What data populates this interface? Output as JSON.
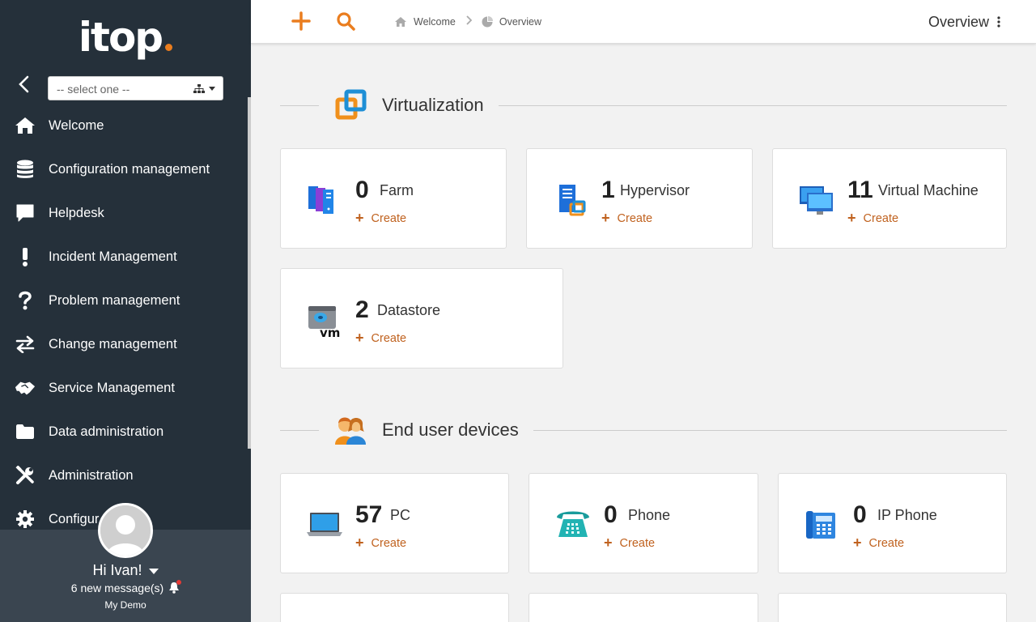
{
  "brand": {
    "name": "itop",
    "accent": "#ea7d1e"
  },
  "org_select": {
    "placeholder": "-- select one --"
  },
  "menu": [
    {
      "label": "Welcome",
      "icon": "home-icon"
    },
    {
      "label": "Configuration management",
      "icon": "database-icon"
    },
    {
      "label": "Helpdesk",
      "icon": "chat-icon"
    },
    {
      "label": "Incident Management",
      "icon": "exclamation-icon"
    },
    {
      "label": "Problem management",
      "icon": "question-icon"
    },
    {
      "label": "Change management",
      "icon": "arrows-exchange-icon"
    },
    {
      "label": "Service Management",
      "icon": "handshake-icon"
    },
    {
      "label": "Data administration",
      "icon": "folder-icon"
    },
    {
      "label": "Administration",
      "icon": "tools-icon"
    },
    {
      "label": "Configur",
      "icon": "gear-icon"
    }
  ],
  "user": {
    "greeting": "Hi Ivan!",
    "messages": "6 new message(s)",
    "org": "My Demo"
  },
  "breadcrumb": [
    {
      "label": "Welcome",
      "icon": "home-icon"
    },
    {
      "label": "Overview",
      "icon": "pie-chart-icon"
    }
  ],
  "page_title": "Overview",
  "sections": [
    {
      "title": "Virtualization",
      "cards": [
        {
          "count": "0",
          "label": "Farm",
          "create": "Create",
          "icon": "farm-icon"
        },
        {
          "count": "1",
          "label": "Hypervisor",
          "create": "Create",
          "icon": "hypervisor-icon"
        },
        {
          "count": "11",
          "label": "Virtual Machine",
          "create": "Create",
          "icon": "virtual-machine-icon"
        },
        {
          "count": "2",
          "label": "Datastore",
          "create": "Create",
          "icon": "datastore-icon"
        }
      ]
    },
    {
      "title": "End user devices",
      "cards": [
        {
          "count": "57",
          "label": "PC",
          "create": "Create",
          "icon": "laptop-icon"
        },
        {
          "count": "0",
          "label": "Phone",
          "create": "Create",
          "icon": "phone-icon"
        },
        {
          "count": "0",
          "label": "IP Phone",
          "create": "Create",
          "icon": "ip-phone-icon"
        }
      ]
    }
  ]
}
